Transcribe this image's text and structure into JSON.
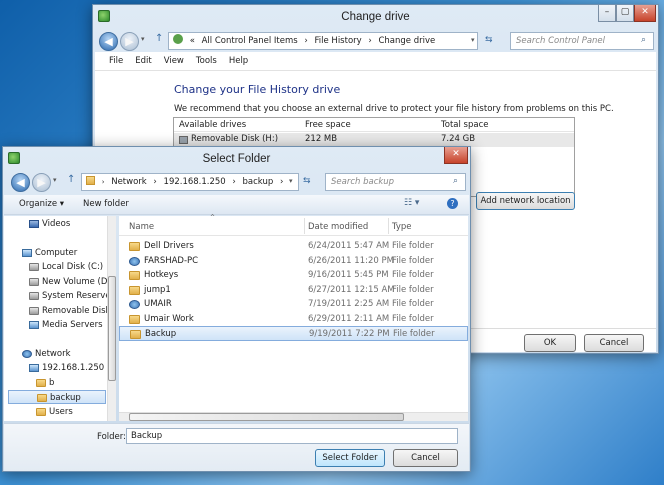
{
  "change_drive": {
    "title": "Change drive",
    "controls": {
      "minimize": "–",
      "maximize": "▢",
      "close": "✕"
    },
    "breadcrumb": [
      "«",
      "All Control Panel Items",
      "›",
      "File History",
      "›",
      "Change drive"
    ],
    "search_placeholder": "Search Control Panel",
    "menu": [
      "File",
      "Edit",
      "View",
      "Tools",
      "Help"
    ],
    "heading": "Change your File History drive",
    "description": "We recommend that you choose an external drive to protect your file history from problems on this PC.",
    "columns": [
      "Available drives",
      "Free space",
      "Total space"
    ],
    "drives": [
      {
        "name": "Removable Disk (H:)",
        "free": "212 MB",
        "total": "7.24 GB"
      }
    ],
    "add_network_label": "Add network location",
    "ok_label": "OK",
    "cancel_label": "Cancel"
  },
  "select_folder": {
    "title": "Select Folder",
    "controls": {
      "close": "✕"
    },
    "breadcrumb": [
      "Network",
      "›",
      "192.168.1.250",
      "›",
      "backup",
      "›"
    ],
    "search_placeholder": "Search backup",
    "organize_label": "Organize ▾",
    "new_folder_label": "New folder",
    "columns": {
      "name": "Name",
      "date": "Date modified",
      "type": "Type"
    },
    "nav": [
      {
        "label": "Videos",
        "icon": "video-icon"
      },
      {
        "label": "Computer",
        "icon": "computer-icon"
      },
      {
        "label": "Local Disk (C:)",
        "icon": "drive-icon"
      },
      {
        "label": "New Volume (D:)",
        "icon": "drive-icon"
      },
      {
        "label": "System Reserved",
        "icon": "drive-icon"
      },
      {
        "label": "Removable Disk",
        "icon": "drive-icon"
      },
      {
        "label": "Media Servers",
        "icon": "media-icon"
      },
      {
        "label": "Network",
        "icon": "network-icon"
      },
      {
        "label": "192.168.1.250",
        "icon": "computer-icon"
      },
      {
        "label": "b",
        "icon": "folder-icon"
      },
      {
        "label": "backup",
        "icon": "folder-icon"
      },
      {
        "label": "Users",
        "icon": "folder-icon"
      }
    ],
    "files": [
      {
        "name": "Dell Drivers",
        "date": "6/24/2011 5:47 AM",
        "type": "File folder",
        "icon": "folder-icon"
      },
      {
        "name": "FARSHAD-PC",
        "date": "6/26/2011 11:20 PM",
        "type": "File folder",
        "icon": "network-folder-icon"
      },
      {
        "name": "Hotkeys",
        "date": "9/16/2011 5:45 PM",
        "type": "File folder",
        "icon": "folder-icon"
      },
      {
        "name": "jump1",
        "date": "6/27/2011 12:15 AM",
        "type": "File folder",
        "icon": "folder-icon"
      },
      {
        "name": "UMAIR",
        "date": "7/19/2011 2:25 AM",
        "type": "File folder",
        "icon": "network-folder-icon"
      },
      {
        "name": "Umair Work",
        "date": "6/29/2011 2:11 AM",
        "type": "File folder",
        "icon": "folder-icon"
      },
      {
        "name": "Backup",
        "date": "9/19/2011 7:22 PM",
        "type": "File folder",
        "icon": "folder-icon"
      }
    ],
    "folder_label": "Folder:",
    "folder_value": "Backup",
    "select_label": "Select Folder",
    "cancel_label": "Cancel"
  }
}
